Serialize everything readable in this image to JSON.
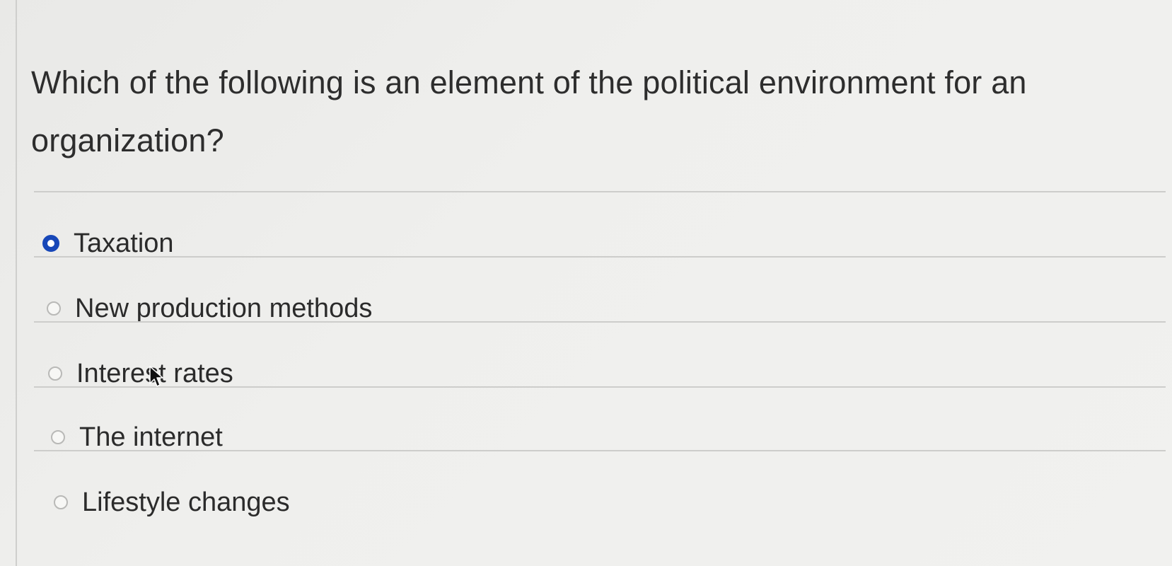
{
  "question": {
    "text": "Which of the following is an element of the political environment for an organization?"
  },
  "options": [
    {
      "label": "Taxation",
      "selected": true
    },
    {
      "label": "New production methods",
      "selected": false
    },
    {
      "label": "Interest rates",
      "selected": false
    },
    {
      "label": "The internet",
      "selected": false
    },
    {
      "label": "Lifestyle changes",
      "selected": false
    }
  ],
  "colors": {
    "selected_radio": "#1747b8",
    "background": "#efefed"
  },
  "icons": {
    "pointer": "mouse-pointer-icon"
  }
}
